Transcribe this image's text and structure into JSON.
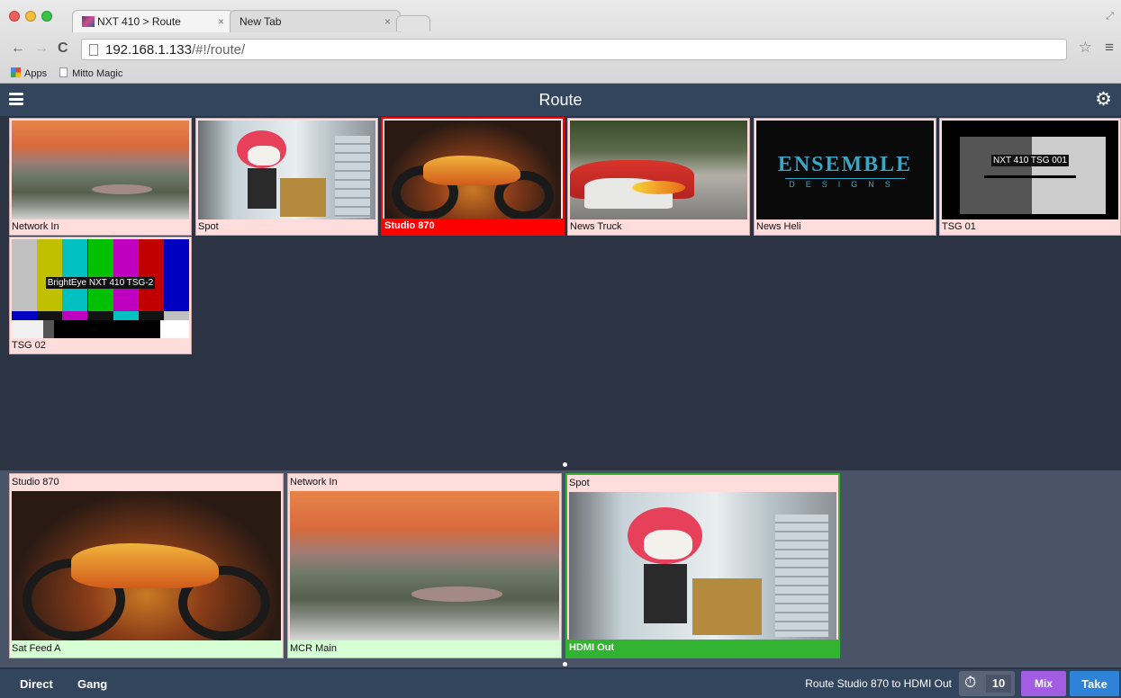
{
  "browser": {
    "tabs": [
      {
        "label": "NXT 410 > Route",
        "active": true
      },
      {
        "label": "New Tab",
        "active": false
      }
    ],
    "close_glyph": "×",
    "url_host": "192.168.1.133",
    "url_path": "/#!/route/",
    "bookmarks": [
      "Apps",
      "Mitto Magic"
    ]
  },
  "app": {
    "title": "Route",
    "menu_icon": "hamburger-icon",
    "settings_icon": "gear-icon"
  },
  "sources": [
    {
      "label": "Network In",
      "art": "landscape",
      "selected": false
    },
    {
      "label": "Spot",
      "art": "spot",
      "selected": false
    },
    {
      "label": "Studio 870",
      "art": "moto",
      "selected": true
    },
    {
      "label": "News Truck",
      "art": "cars",
      "selected": false
    },
    {
      "label": "News Heli",
      "art": "ensemble",
      "selected": false
    },
    {
      "label": "TSG 01",
      "art": "tsg1",
      "selected": false
    },
    {
      "label": "TSG 02",
      "art": "bars",
      "selected": false
    }
  ],
  "thumb_text": {
    "ensemble_logo": "ENSEMBLE",
    "ensemble_sub": "DESIGNS",
    "tsg1_caption": "NXT 410 TSG 001",
    "tsg2_caption": "BrightEye NXT 410 TSG-2"
  },
  "destinations": [
    {
      "source": "Studio 870",
      "label": "Sat Feed A",
      "art": "moto",
      "active": false
    },
    {
      "source": "Network In",
      "label": "MCR Main",
      "art": "landscape",
      "active": false
    },
    {
      "source": "Spot",
      "label": "HDMI Out",
      "art": "spot",
      "active": true
    }
  ],
  "footer": {
    "direct": "Direct",
    "gang": "Gang",
    "status": "Route Studio 870 to HDMI Out",
    "timer_value": "10",
    "mix": "Mix",
    "take": "Take"
  },
  "colors": {
    "header": "#33455c",
    "source_bg": "#2c3443",
    "dest_bg": "#4a5468",
    "selected_source": "#ff0000",
    "active_dest": "#32b432",
    "mix": "#a25de2",
    "take": "#2e82d8"
  }
}
